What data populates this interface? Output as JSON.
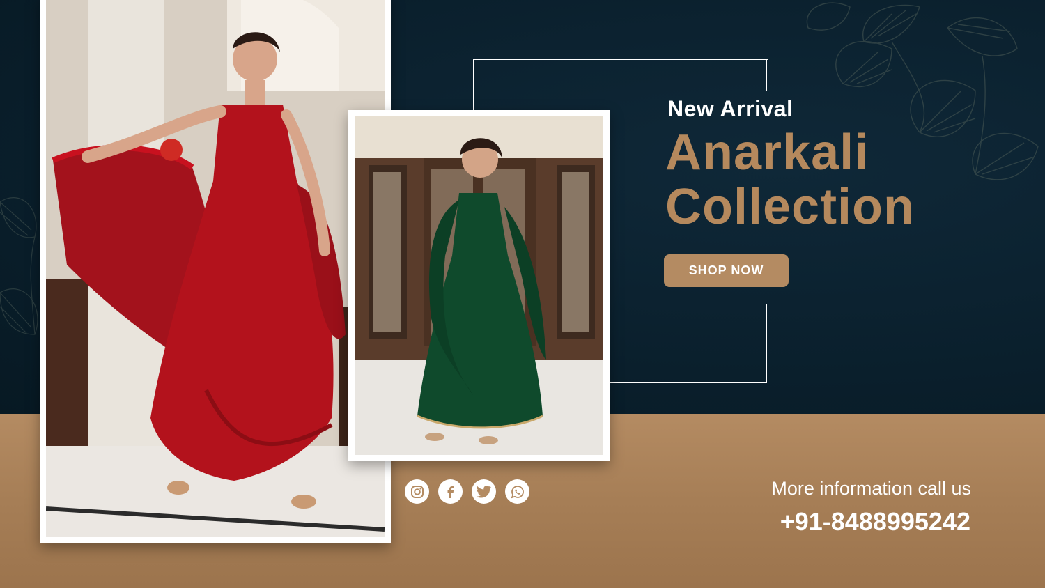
{
  "banner": {
    "eyebrow": "New Arrival",
    "headline_line1": "Anarkali",
    "headline_line2": "Collection",
    "cta_label": "SHOP NOW"
  },
  "contact": {
    "label": "More information call us",
    "phone": "+91-8488995242"
  },
  "socials": [
    {
      "icon": "instagram-icon"
    },
    {
      "icon": "facebook-icon"
    },
    {
      "icon": "twitter-icon"
    },
    {
      "icon": "whatsapp-icon"
    }
  ],
  "colors": {
    "navy_background": "#0a1f2c",
    "accent_gold": "#b48b62",
    "text_light": "#ffffff"
  }
}
